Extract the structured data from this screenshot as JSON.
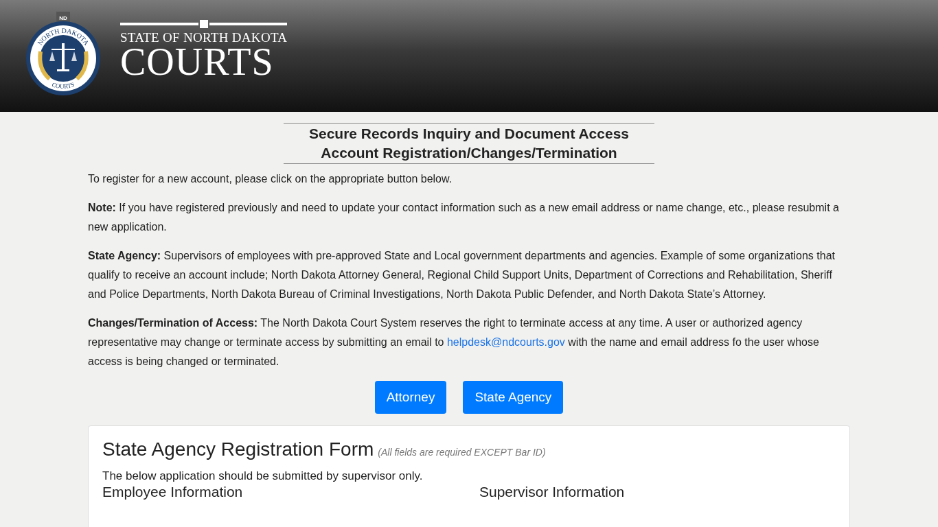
{
  "header": {
    "seal": {
      "badge": "ND",
      "top_text": "NORTH DAKOTA",
      "bottom_text": "COURTS"
    },
    "wordmark": {
      "line_1": "STATE OF NORTH DAKOTA",
      "line_2": "COURTS"
    }
  },
  "title": {
    "line_1": "Secure Records Inquiry and Document Access",
    "line_2": "Account Registration/Changes/Termination"
  },
  "paragraphs": [
    {
      "text": "To register for a new account, please click on the appropriate button below."
    },
    {
      "text": "**Note:** If you have registered previously and need to update your contact information such as a new email address or name change, etc., please resubmit a new application."
    },
    {
      "text": "**State Agency:** Supervisors of employees with pre-approved State and Local government departments and agencies. Example of some organizations that qualify to receive an account include; North Dakota Attorney General, Regional Child Support Units, Department of Corrections and Rehabilitation, Sheriff and Police Departments, North Dakota Bureau of Criminal Investigations, North Dakota Public Defender, and North Dakota State’s Attorney."
    },
    {
      "text": "**Changes/Termination of Access:** The North Dakota Court System reserves the right to terminate access at any time. A user or authorized agency representative may change or terminate access by submitting an email to",
      "link": "helpdesk@ndcourts.gov",
      "text_after": "with the name and email address fo the user whose access is being changed or terminated."
    }
  ],
  "buttons": [
    "Attorney",
    "State Agency"
  ],
  "form": {
    "title": "State Agency Registration Form",
    "note": "(All fields are required EXCEPT Bar ID)",
    "intro": "The below application should be submitted by supervisor only.",
    "sections": [
      "Employee Information",
      "Supervisor Information"
    ]
  }
}
